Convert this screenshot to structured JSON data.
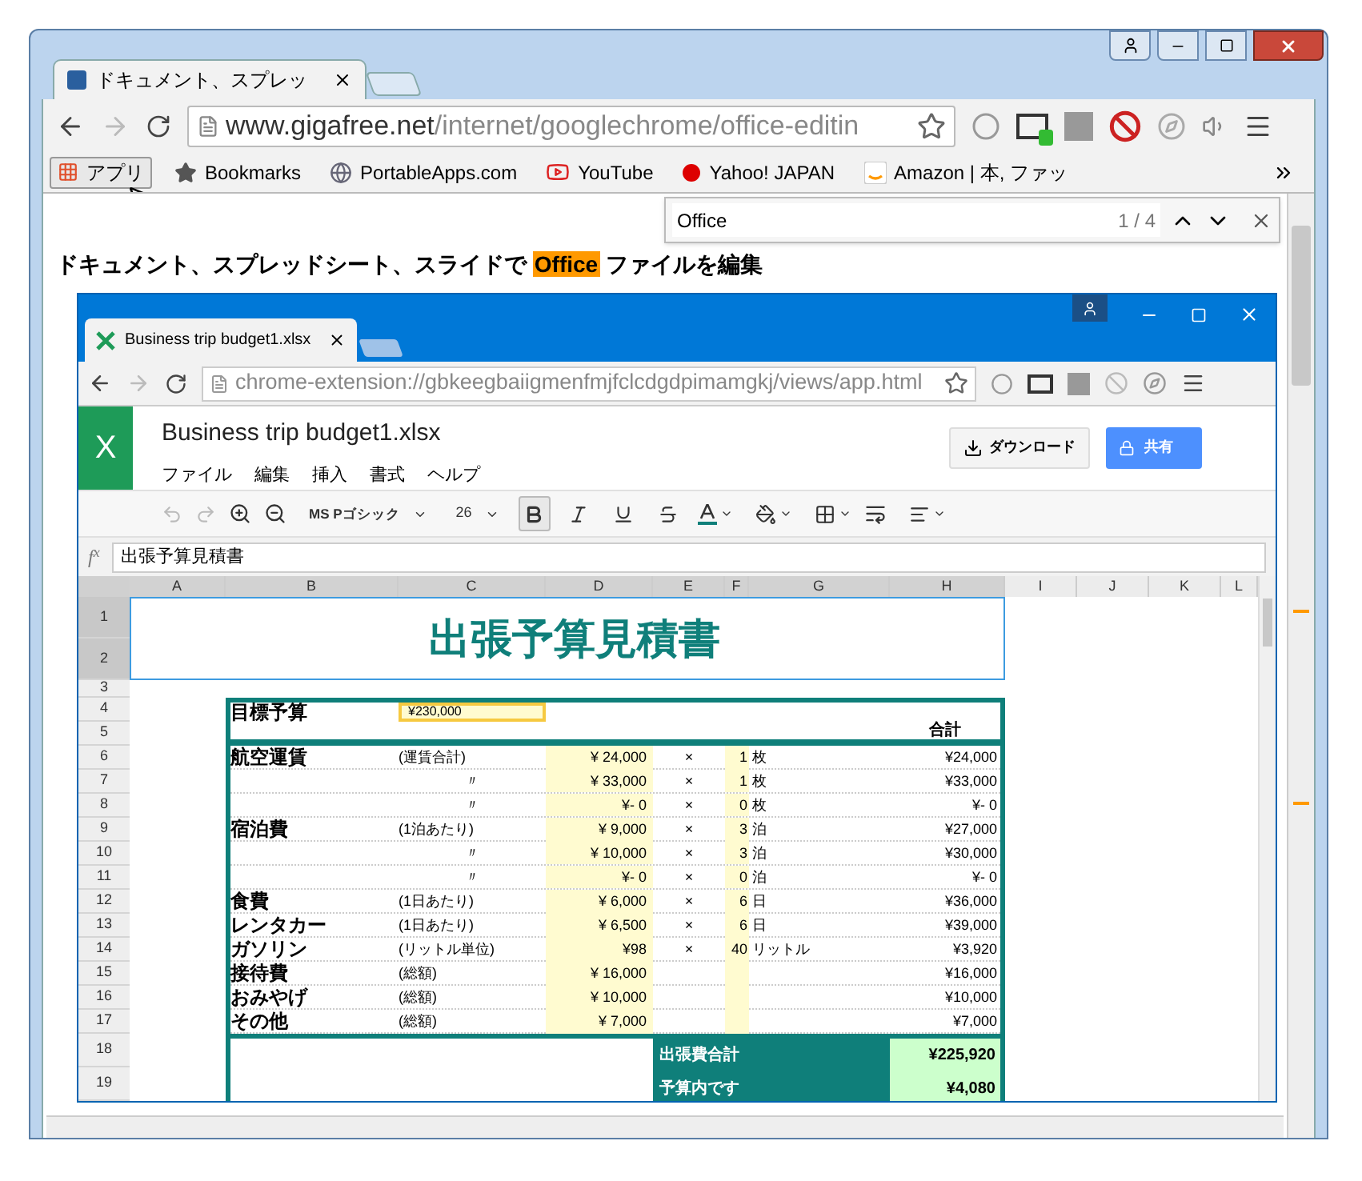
{
  "window": {
    "tab_title": "ドキュメント、スプレッ"
  },
  "toolbar": {
    "url_domain": "www.gigafree.net",
    "url_path": "/internet/googlechrome/office-editin"
  },
  "bookmarks": [
    {
      "label": "アプリ",
      "kind": "apps"
    },
    {
      "label": "Bookmarks",
      "kind": "star"
    },
    {
      "label": "PortableApps.com",
      "kind": "globe"
    },
    {
      "label": "YouTube",
      "kind": "youtube"
    },
    {
      "label": "Yahoo! JAPAN",
      "kind": "yahoo"
    },
    {
      "label": "Amazon | 本, ファッ",
      "kind": "amazon"
    }
  ],
  "find_bar": {
    "value": "Office",
    "count": "1 / 4"
  },
  "page": {
    "heading_before": "ドキュメント、スプレッドシート、スライドで",
    "highlight": "Office",
    "heading_after": "ファイルを編集"
  },
  "app": {
    "tab_title": "Business trip budget1.xlsx",
    "url": "chrome-extension://gbkeegbaiigmenfmjfclcdgdpimamgkj/views/app.html",
    "logo": "X",
    "file_name": "Business trip budget1.xlsx",
    "menus": [
      "ファイル",
      "編集",
      "挿入",
      "書式",
      "ヘルプ"
    ],
    "download": "ダウンロード",
    "share": "共有",
    "font": "MS Pゴシック",
    "font_size": "26",
    "format_buttons": [
      {
        "kind": "bold",
        "selected": true
      },
      {
        "kind": "italic",
        "selected": false
      },
      {
        "kind": "underline",
        "selected": false
      },
      {
        "kind": "strike",
        "selected": false
      }
    ],
    "fx_label": "f$^{x}$",
    "formula": "出張予算見積書",
    "columns": [
      {
        "label": "A",
        "selected": true
      },
      {
        "label": "B",
        "selected": true
      },
      {
        "label": "C",
        "selected": true
      },
      {
        "label": "D",
        "selected": true
      },
      {
        "label": "E",
        "selected": true
      },
      {
        "label": "F",
        "selected": true
      },
      {
        "label": "G",
        "selected": true
      },
      {
        "label": "H",
        "selected": true
      },
      {
        "label": "I",
        "selected": false
      },
      {
        "label": "J",
        "selected": false
      },
      {
        "label": "K",
        "selected": false
      },
      {
        "label": "L",
        "selected": false
      }
    ],
    "rows": [
      {
        "label": "1",
        "selected": true
      },
      {
        "label": "2",
        "selected": true
      },
      {
        "label": "3",
        "selected": false
      },
      {
        "label": "4",
        "selected": false
      },
      {
        "label": "5",
        "selected": false
      },
      {
        "label": "6",
        "selected": false
      },
      {
        "label": "7",
        "selected": false
      },
      {
        "label": "8",
        "selected": false
      },
      {
        "label": "9",
        "selected": false
      },
      {
        "label": "10",
        "selected": false
      },
      {
        "label": "11",
        "selected": false
      },
      {
        "label": "12",
        "selected": false
      },
      {
        "label": "13",
        "selected": false
      },
      {
        "label": "14",
        "selected": false
      },
      {
        "label": "15",
        "selected": false
      },
      {
        "label": "16",
        "selected": false
      },
      {
        "label": "17",
        "selected": false
      },
      {
        "label": "18",
        "selected": false
      },
      {
        "label": "19",
        "selected": false
      }
    ],
    "sheet": {
      "title": "出張予算見積書",
      "budget_label": "目標予算",
      "budget_value": "¥230,000",
      "total_header": "合計",
      "items": [
        {
          "label": "航空運賃",
          "note": "(運賃合計)",
          "price": "¥ 24,000",
          "times": "×",
          "qty": "1",
          "unit": "枚",
          "total": "¥24,000"
        },
        {
          "note": "〃",
          "price": "¥ 33,000",
          "times": "×",
          "qty": "1",
          "unit": "枚",
          "total": "¥33,000"
        },
        {
          "note": "〃",
          "price": "¥- 0",
          "times": "×",
          "qty": "0",
          "unit": "枚",
          "total": "¥- 0"
        },
        {
          "label": "宿泊費",
          "note": "(1泊あたり)",
          "price": "¥ 9,000",
          "times": "×",
          "qty": "3",
          "unit": "泊",
          "total": "¥27,000"
        },
        {
          "note": "〃",
          "price": "¥ 10,000",
          "times": "×",
          "qty": "3",
          "unit": "泊",
          "total": "¥30,000"
        },
        {
          "note": "〃",
          "price": "¥- 0",
          "times": "×",
          "qty": "0",
          "unit": "泊",
          "total": "¥- 0"
        },
        {
          "label": "食費",
          "note": "(1日あたり)",
          "price": "¥ 6,000",
          "times": "×",
          "qty": "6",
          "unit": "日",
          "total": "¥36,000"
        },
        {
          "label": "レンタカー",
          "note": "(1日あたり)",
          "price": "¥ 6,500",
          "times": "×",
          "qty": "6",
          "unit": "日",
          "total": "¥39,000"
        },
        {
          "label": "ガソリン",
          "note": "(リットル単位)",
          "price": "¥98",
          "times": "×",
          "qty": "40",
          "unit": "リットル",
          "total": "¥3,920"
        },
        {
          "label": "接待費",
          "note": "(総額)",
          "price": "¥ 16,000",
          "total": "¥16,000"
        },
        {
          "label": "おみやげ",
          "note": "(総額)",
          "price": "¥ 10,000",
          "total": "¥10,000"
        },
        {
          "label": "その他",
          "note": "(総額)",
          "price": "¥ 7,000",
          "total": "¥7,000"
        }
      ],
      "summary": [
        {
          "label": "出張費合計",
          "value": "¥225,920"
        },
        {
          "label": "予算内です",
          "value": "¥4,080"
        }
      ]
    }
  }
}
